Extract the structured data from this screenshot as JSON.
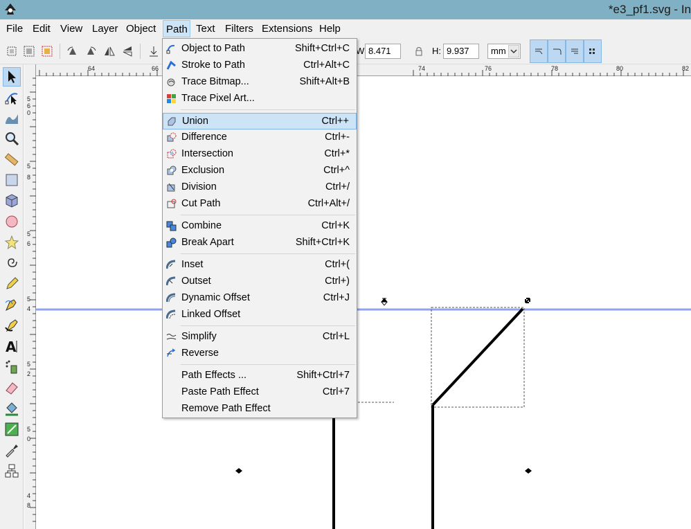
{
  "window": {
    "title": "*e3_pf1.svg - In"
  },
  "menubar": {
    "items": [
      "File",
      "Edit",
      "View",
      "Layer",
      "Object",
      "Path",
      "Text",
      "Filters",
      "Extensions",
      "Help"
    ],
    "active": "Path"
  },
  "toolbar": {
    "w_label": "W:",
    "w_value": "8.471",
    "h_label": "H:",
    "h_value": "9.937",
    "unit": "mm"
  },
  "ruler": {
    "top_ticks": [
      "64",
      "66",
      "74",
      "76",
      "78",
      "80",
      "82"
    ],
    "left_ticks": [
      "5",
      "6",
      "0",
      "5",
      "8",
      "5",
      "6",
      "5",
      "4",
      "5",
      "2",
      "5",
      "0",
      "4",
      "8"
    ]
  },
  "path_menu": {
    "items": [
      {
        "label": "Object to Path",
        "shortcut": "Shift+Ctrl+C",
        "icon": "object-to-path-icon"
      },
      {
        "label": "Stroke to Path",
        "shortcut": "Ctrl+Alt+C",
        "icon": "stroke-to-path-icon"
      },
      {
        "label": "Trace Bitmap...",
        "shortcut": "Shift+Alt+B",
        "icon": "trace-bitmap-icon"
      },
      {
        "label": "Trace Pixel Art...",
        "shortcut": "",
        "icon": "trace-pixel-art-icon"
      },
      {
        "label": "Union",
        "shortcut": "Ctrl++",
        "icon": "union-icon",
        "highlighted": true
      },
      {
        "label": "Difference",
        "shortcut": "Ctrl+-",
        "icon": "difference-icon"
      },
      {
        "label": "Intersection",
        "shortcut": "Ctrl+*",
        "icon": "intersection-icon"
      },
      {
        "label": "Exclusion",
        "shortcut": "Ctrl+^",
        "icon": "exclusion-icon"
      },
      {
        "label": "Division",
        "shortcut": "Ctrl+/",
        "icon": "division-icon"
      },
      {
        "label": "Cut Path",
        "shortcut": "Ctrl+Alt+/",
        "icon": "cut-path-icon"
      },
      {
        "label": "Combine",
        "shortcut": "Ctrl+K",
        "icon": "combine-icon"
      },
      {
        "label": "Break Apart",
        "shortcut": "Shift+Ctrl+K",
        "icon": "break-apart-icon"
      },
      {
        "label": "Inset",
        "shortcut": "Ctrl+(",
        "icon": "inset-icon"
      },
      {
        "label": "Outset",
        "shortcut": "Ctrl+)",
        "icon": "outset-icon"
      },
      {
        "label": "Dynamic Offset",
        "shortcut": "Ctrl+J",
        "icon": "dynamic-offset-icon"
      },
      {
        "label": "Linked Offset",
        "shortcut": "",
        "icon": "linked-offset-icon"
      },
      {
        "label": "Simplify",
        "shortcut": "Ctrl+L",
        "icon": "simplify-icon"
      },
      {
        "label": "Reverse",
        "shortcut": "",
        "icon": "reverse-icon"
      },
      {
        "label": "Path Effects ...",
        "shortcut": "Shift+Ctrl+7",
        "icon": ""
      },
      {
        "label": "Paste Path Effect",
        "shortcut": "Ctrl+7",
        "icon": ""
      },
      {
        "label": "Remove Path Effect",
        "shortcut": "",
        "icon": ""
      }
    ]
  },
  "colors": {
    "titlebar": "#7fb0c3",
    "highlight": "#cde4f7",
    "guide": "#8fa3f0"
  }
}
